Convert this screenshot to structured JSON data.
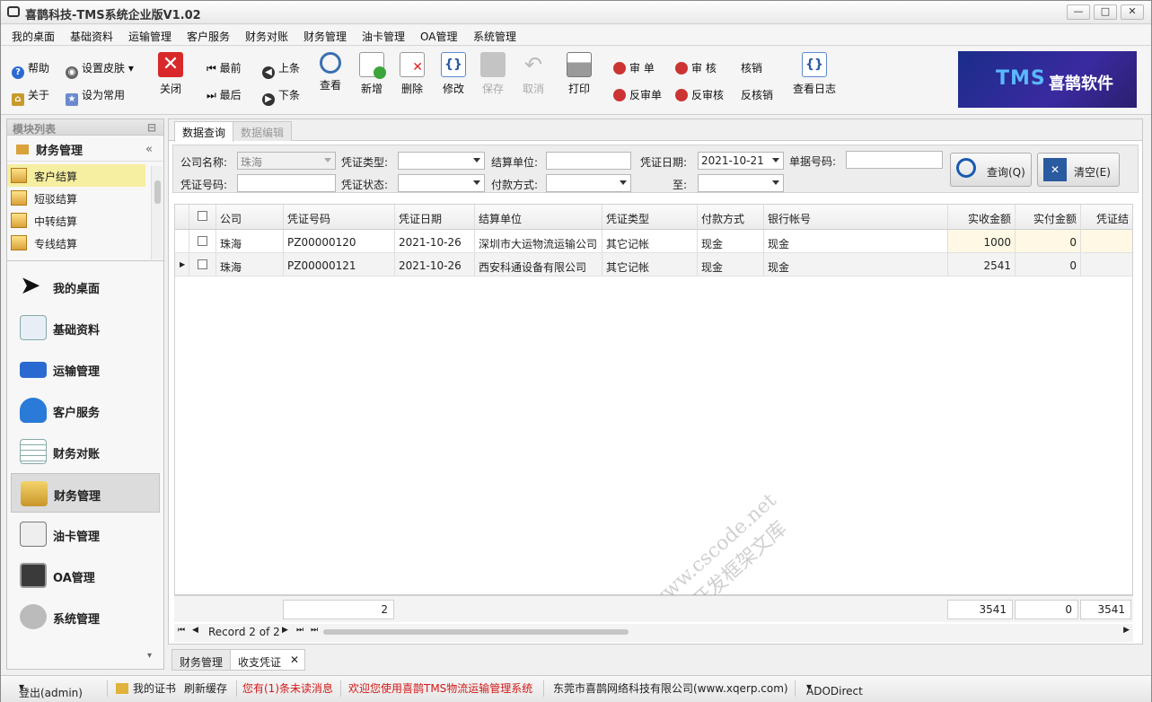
{
  "app": {
    "title": "喜鹊科技-TMS系统企业版V1.02"
  },
  "menu": [
    "我的桌面",
    "基础资料",
    "运输管理",
    "客户服务",
    "财务对账",
    "财务管理",
    "油卡管理",
    "OA管理",
    "系统管理"
  ],
  "toolbar": {
    "help": "帮助",
    "skin": "设置皮肤",
    "about": "关于",
    "favorite": "设为常用",
    "close": "关闭",
    "first": "最前",
    "last": "最后",
    "prev": "上条",
    "next": "下条",
    "view": "查看",
    "add": "新增",
    "delete": "删除",
    "edit": "修改",
    "save": "保存",
    "cancel": "取消",
    "print": "打印",
    "audit": "审 单",
    "unaudit": "反审单",
    "review": "审 核",
    "unreview": "反审核",
    "writeoff": "核销",
    "unwriteoff": "反核销",
    "log": "查看日志"
  },
  "banner": {
    "tms": "TMS",
    "brand": "喜鹊软件"
  },
  "left": {
    "header": "模块列表",
    "module": "财务管理",
    "tree": [
      "客户结算",
      "短驳结算",
      "中转结算",
      "专线结算"
    ],
    "nav": [
      "我的桌面",
      "基础资料",
      "运输管理",
      "客户服务",
      "财务对账",
      "财务管理",
      "油卡管理",
      "OA管理",
      "系统管理"
    ]
  },
  "tabs": {
    "query": "数据查询",
    "edit": "数据编辑"
  },
  "query": {
    "company_label": "公司名称:",
    "company_value": "珠海",
    "voucher_type_label": "凭证类型:",
    "settle_unit_label": "结算单位:",
    "date_label": "凭证日期:",
    "date_from": "2021-10-21",
    "doc_no_label": "单据号码:",
    "voucher_no_label": "凭证号码:",
    "status_label": "凭证状态:",
    "pay_method_label": "付款方式:",
    "to_label": "至:",
    "query_btn": "查询(Q)",
    "clear_btn": "清空(E)"
  },
  "grid": {
    "columns": [
      "公司",
      "凭证号码",
      "凭证日期",
      "结算单位",
      "凭证类型",
      "付款方式",
      "银行帐号",
      "实收金额",
      "实付金额",
      "凭证结"
    ],
    "rows": [
      [
        "珠海",
        "PZ00000120",
        "2021-10-26",
        "深圳市大运物流运输公司",
        "其它记帐",
        "现金",
        "现金",
        "1000",
        "0"
      ],
      [
        "珠海",
        "PZ00000121",
        "2021-10-26",
        "西安科通设备有限公司",
        "其它记帐",
        "现金",
        "现金",
        "2541",
        "0"
      ]
    ],
    "footer": {
      "count": "2",
      "recv": "3541",
      "paid": "0",
      "net": "3541"
    },
    "pager": "Record 2 of 2"
  },
  "bottom_tabs": [
    "财务管理",
    "收支凭证"
  ],
  "status": {
    "logout": "登出(admin)",
    "cert": "我的证书",
    "refresh": "刷新缓存",
    "msg": "您有(1)条未读消息",
    "welcome": "欢迎您使用喜鹊TMS物流运输管理系统",
    "company": "东莞市喜鹊网络科技有限公司(www.xqerp.com)",
    "db": "ADODirect"
  },
  "watermark": {
    "line1": "www.cscode.net",
    "line2": "开发框架文库"
  }
}
